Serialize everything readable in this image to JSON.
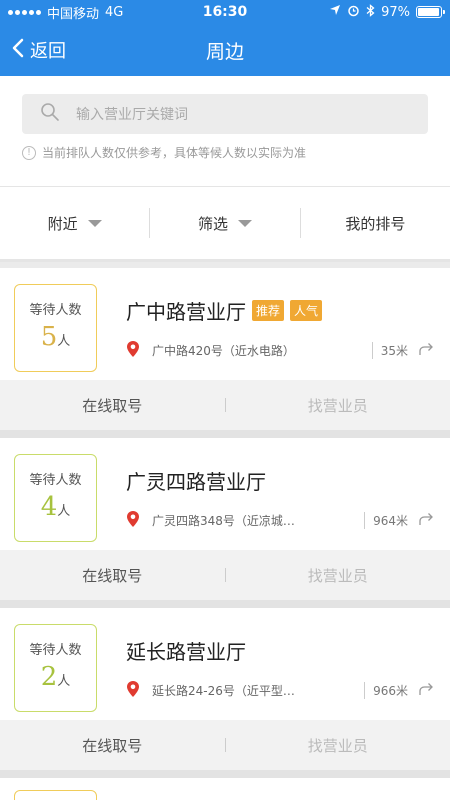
{
  "status_bar": {
    "carrier": "中国移动",
    "network": "4G",
    "time": "16:30",
    "battery": "97%",
    "battery_level": 0.97
  },
  "nav": {
    "back_label": "返回",
    "title": "周边"
  },
  "search": {
    "placeholder": "输入营业厅关键词"
  },
  "notice": "当前排队人数仅供参考，具体等候人数以实际为准",
  "filters": {
    "nearby": "附近",
    "filter": "筛选",
    "my_queue": "我的排号"
  },
  "wait_label": "等待人数",
  "unit_person": "人",
  "actions": {
    "take_number": "在线取号",
    "find_staff": "找营业员"
  },
  "halls": [
    {
      "name": "广中路营业厅",
      "tags": [
        "推荐",
        "人气"
      ],
      "waiting": "5",
      "address": "广中路420号（近水电路）",
      "distance": "35米"
    },
    {
      "name": "广灵四路营业厅",
      "tags": [],
      "waiting": "4",
      "address": "广灵四路348号（近凉城…",
      "distance": "964米"
    },
    {
      "name": "延长路营业厅",
      "tags": [],
      "waiting": "2",
      "address": "延长路24-26号（近平型…",
      "distance": "966米"
    }
  ],
  "colors": {
    "header": "#2b8ae6",
    "tag": "#f0a833",
    "pin": "#e03b30"
  }
}
